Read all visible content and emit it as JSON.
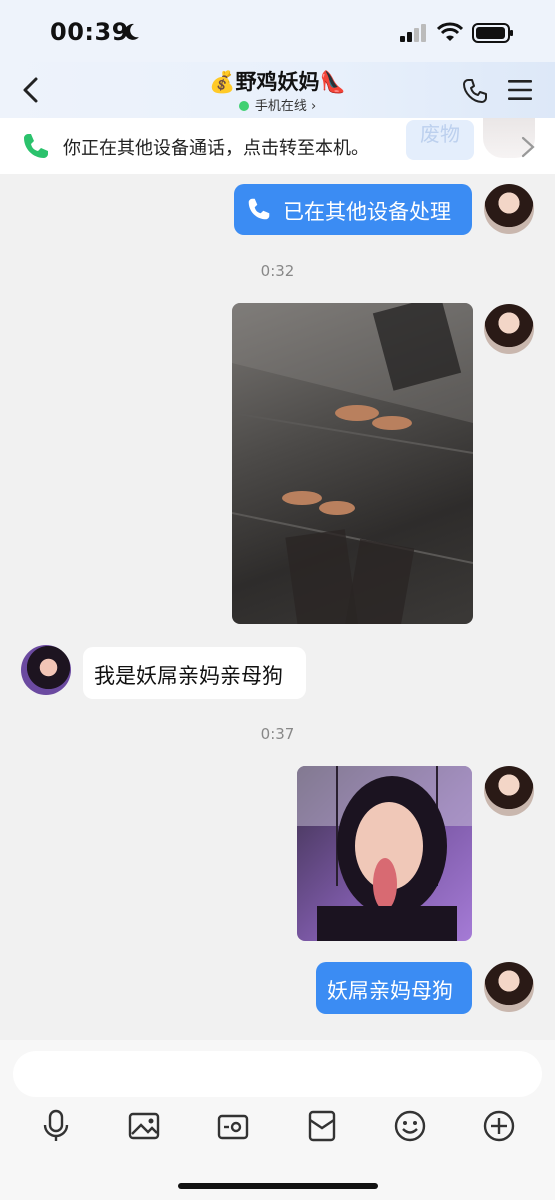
{
  "status": {
    "time": "00:39"
  },
  "header": {
    "title": "💰野鸡妖妈👠",
    "subtitle": "手机在线",
    "subtitle_arrow": "›"
  },
  "banner": {
    "text": "你正在其他设备通话，点击转至本机。",
    "tag": "废物"
  },
  "messages": {
    "call_status": "已在其他设备处理",
    "ts1": "0:32",
    "incoming_text": "我是妖屌亲妈亲母狗",
    "ts2": "0:37",
    "outgoing_text": "妖屌亲妈母狗"
  },
  "icons": {
    "back": "chevron-left-icon",
    "phone": "phone-icon",
    "menu": "menu-icon",
    "voice": "microphone-icon",
    "gallery": "image-icon",
    "camera": "camera-icon",
    "envelope": "envelope-icon",
    "emoji": "emoji-icon",
    "plus": "plus-icon"
  },
  "colors": {
    "accent": "#3b8cf3",
    "online": "#3fd071",
    "call_green": "#2bc26c"
  }
}
